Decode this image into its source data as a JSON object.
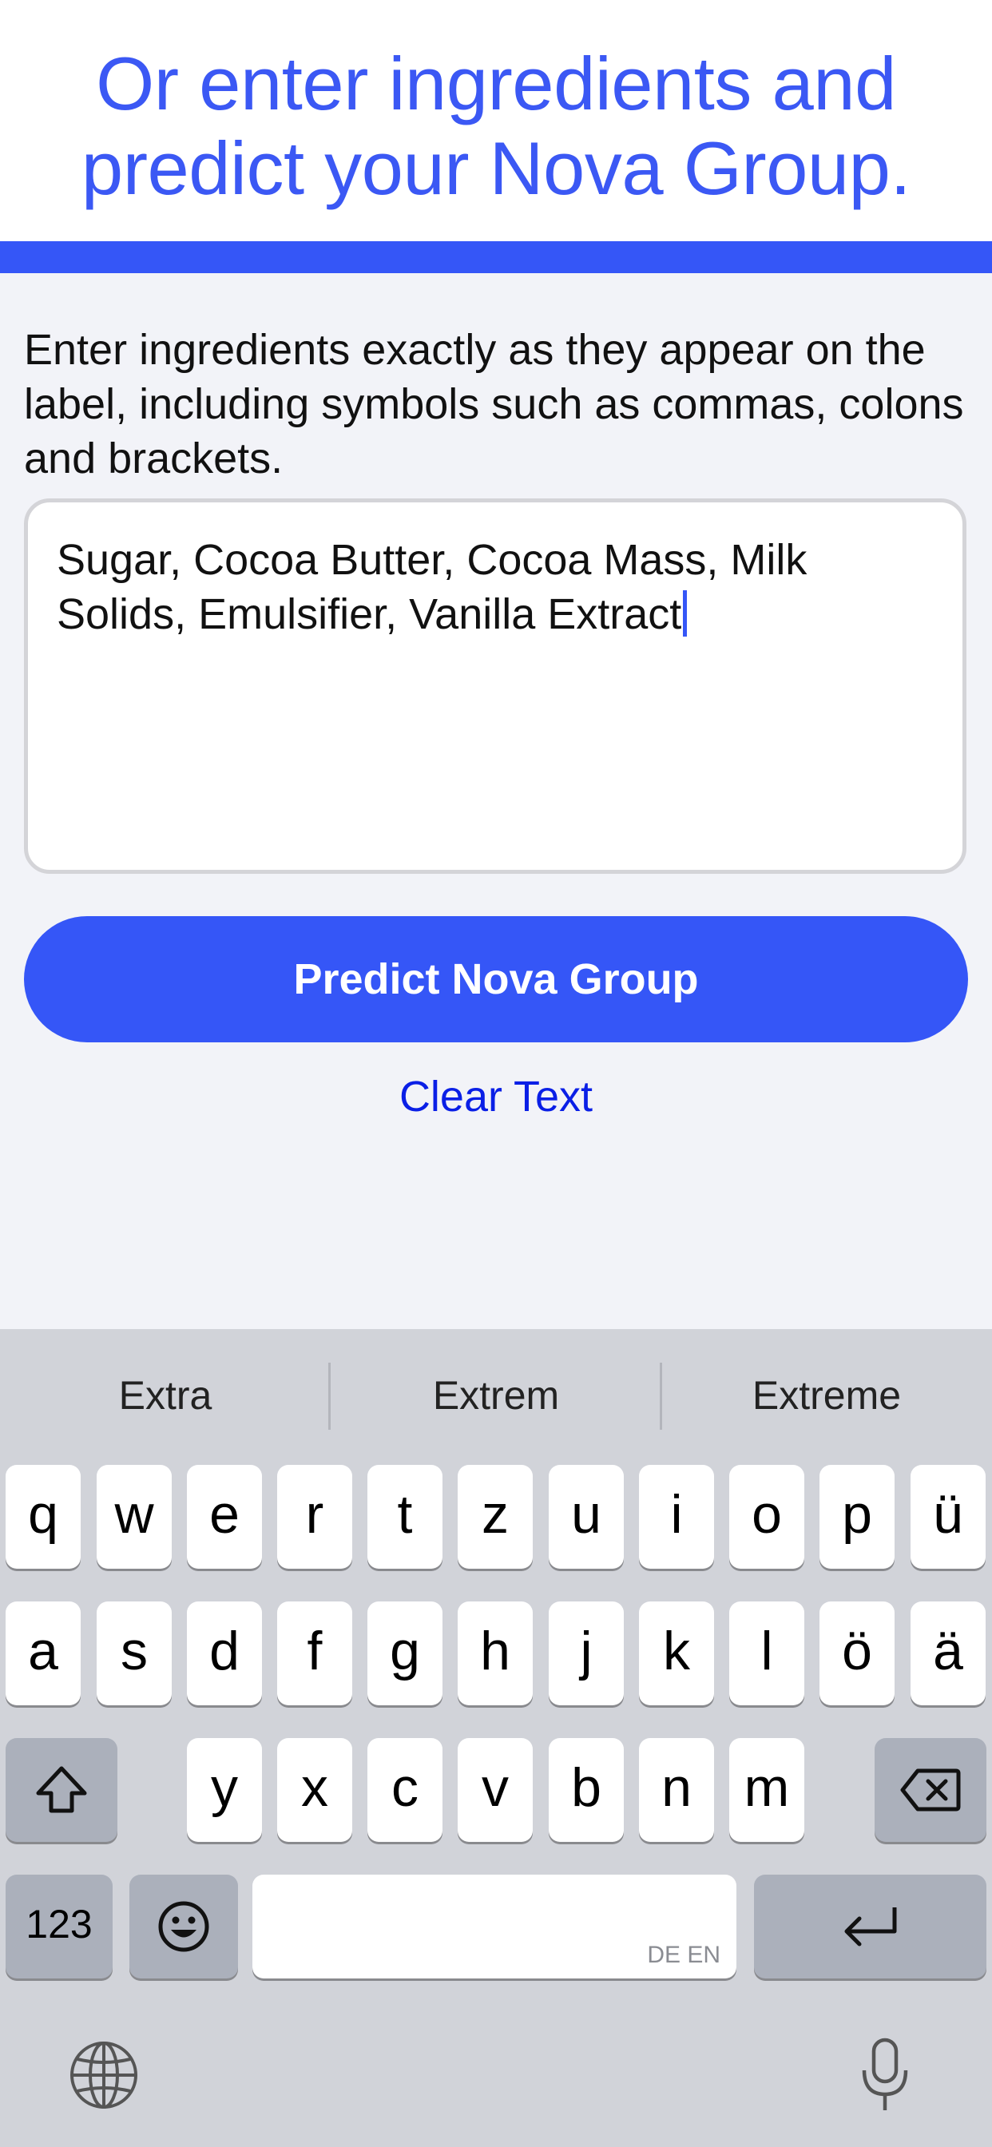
{
  "header": {
    "title_line1": "Or enter ingredients and",
    "title_line2": "predict your Nova Group."
  },
  "instructions": "Enter ingredients exactly as they appear on the label, including symbols such as commas, colons and brackets.",
  "ingredients_input": {
    "value": "Sugar, Cocoa Butter, Cocoa Mass, Milk Solids, Emulsifier, Vanilla Extract"
  },
  "predict_button_label": "Predict Nova Group",
  "clear_text_label": "Clear Text",
  "keyboard": {
    "suggestions": [
      "Extra",
      "Extrem",
      "Extreme"
    ],
    "row1": [
      "q",
      "w",
      "e",
      "r",
      "t",
      "z",
      "u",
      "i",
      "o",
      "p",
      "ü"
    ],
    "row2": [
      "a",
      "s",
      "d",
      "f",
      "g",
      "h",
      "j",
      "k",
      "l",
      "ö",
      "ä"
    ],
    "row3": [
      "y",
      "x",
      "c",
      "v",
      "b",
      "n",
      "m"
    ],
    "numbers_label": "123",
    "space_languages": "DE EN",
    "icons": {
      "shift": "shift-icon",
      "delete": "delete-icon",
      "emoji": "emoji-icon",
      "return": "return-icon",
      "globe": "globe-icon",
      "mic": "microphone-icon"
    }
  },
  "colors": {
    "accent": "#3556f7",
    "title": "#3b58f4",
    "link": "#0a1fe6"
  }
}
